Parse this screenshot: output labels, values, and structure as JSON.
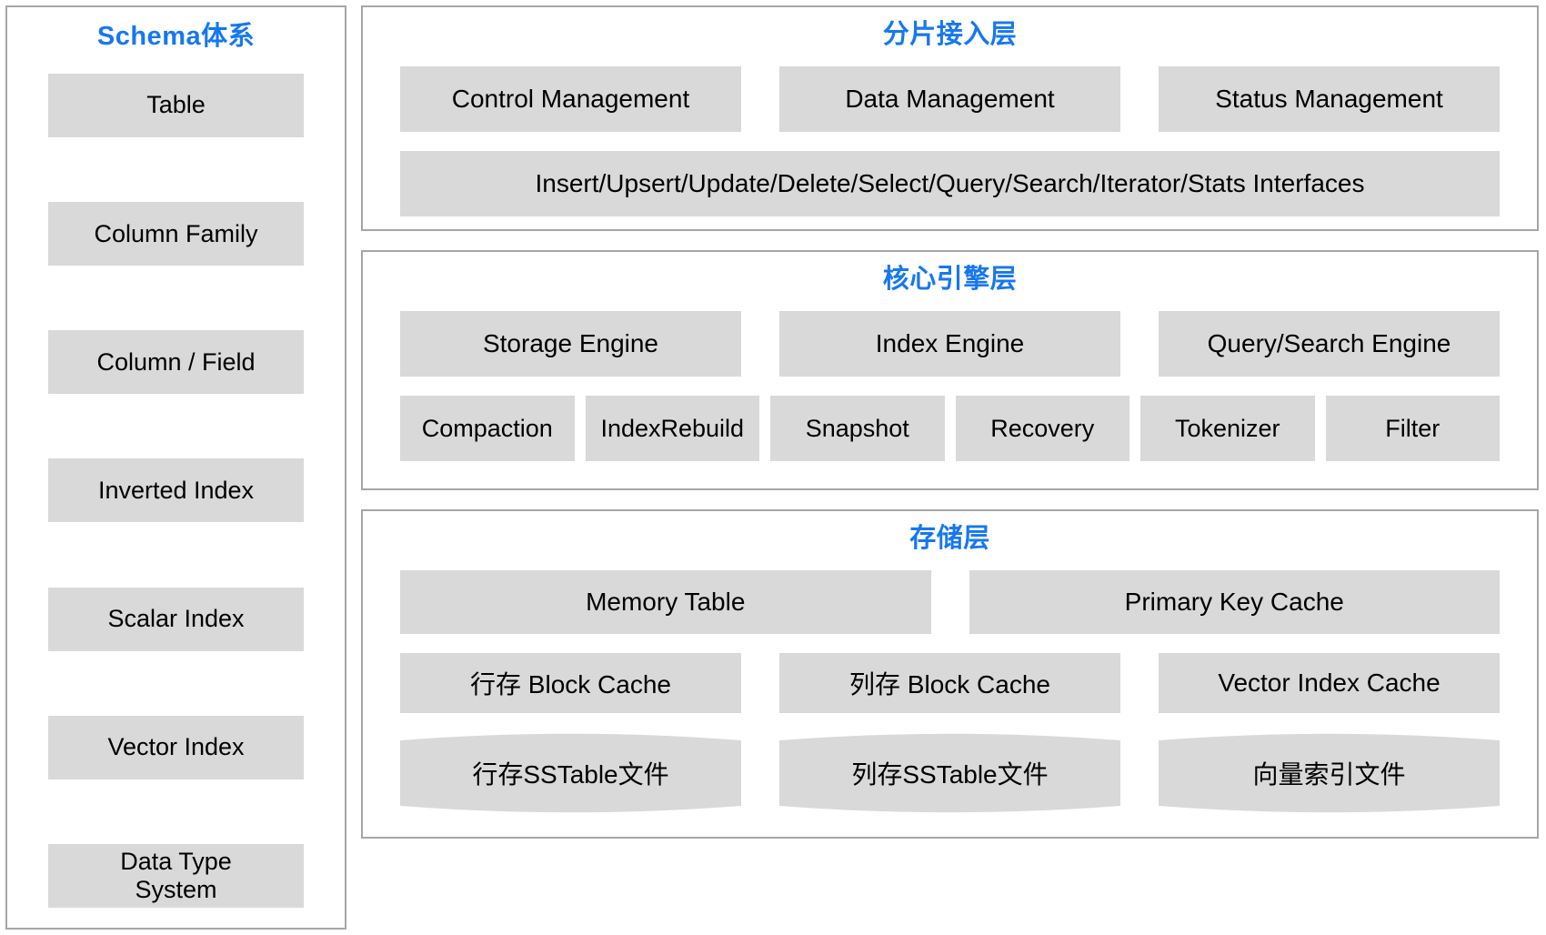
{
  "colors": {
    "accent": "#1677f0",
    "box_fill": "#d9d9d9",
    "panel_border": "#a6a6a6",
    "text": "#000000",
    "background": "#ffffff"
  },
  "schema_panel": {
    "title": "Schema体系",
    "items": [
      {
        "label": "Table"
      },
      {
        "label": "Column Family"
      },
      {
        "label": "Column / Field"
      },
      {
        "label": "Inverted Index"
      },
      {
        "label": "Scalar Index"
      },
      {
        "label": "Vector Index"
      },
      {
        "label": "Data Type\nSystem"
      }
    ]
  },
  "access_layer": {
    "title": "分片接入层",
    "row1": [
      {
        "label": "Control Management"
      },
      {
        "label": "Data Management"
      },
      {
        "label": "Status Management"
      }
    ],
    "row2": [
      {
        "label": "Insert/Upsert/Update/Delete/Select/Query/Search/Iterator/Stats Interfaces"
      }
    ]
  },
  "core_layer": {
    "title": "核心引擎层",
    "row1": [
      {
        "label": "Storage Engine"
      },
      {
        "label": "Index Engine"
      },
      {
        "label": "Query/Search Engine"
      }
    ],
    "row2": [
      {
        "label": "Compaction"
      },
      {
        "label": "IndexRebuild"
      },
      {
        "label": "Snapshot"
      },
      {
        "label": "Recovery"
      },
      {
        "label": "Tokenizer"
      },
      {
        "label": "Filter"
      }
    ]
  },
  "storage_layer": {
    "title": "存储层",
    "row1": [
      {
        "label": "Memory Table"
      },
      {
        "label": "Primary Key Cache"
      }
    ],
    "row2": [
      {
        "label": "行存 Block Cache"
      },
      {
        "label": "列存 Block Cache"
      },
      {
        "label": "Vector Index Cache"
      }
    ],
    "row3": [
      {
        "label": "行存SSTable文件"
      },
      {
        "label": "列存SSTable文件"
      },
      {
        "label": "向量索引文件"
      }
    ]
  }
}
